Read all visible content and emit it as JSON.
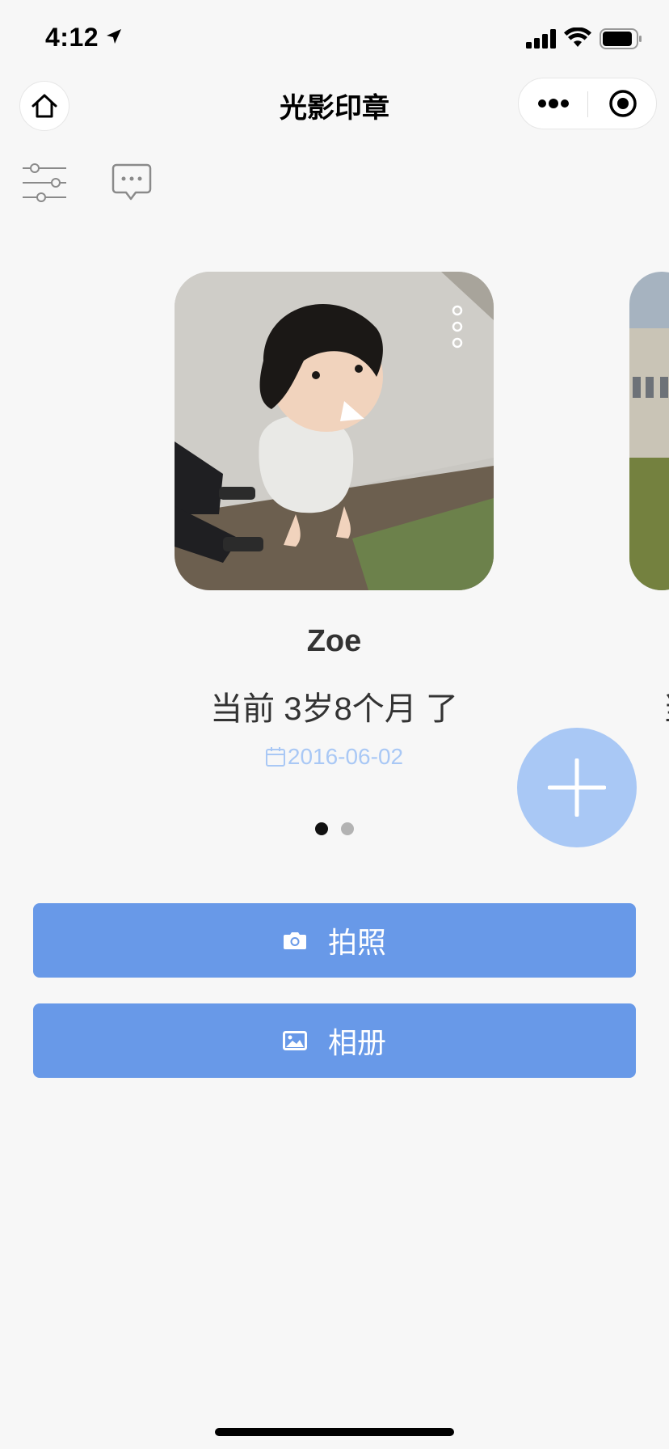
{
  "status_bar": {
    "time": "4:12"
  },
  "nav": {
    "title": "光影印章"
  },
  "card": {
    "name": "Zoe",
    "age_text": "当前 3岁8个月 了",
    "date": "2016-06-02"
  },
  "next_card": {
    "age_text_partial": "当"
  },
  "pagination": {
    "current": 1,
    "total": 2
  },
  "actions": {
    "camera_label": "拍照",
    "album_label": "相册"
  },
  "colors": {
    "primary_button": "#6899e8",
    "fab": "#a9c8f5",
    "date_text": "#a9c8f5",
    "background": "#f7f7f7"
  },
  "icons": {
    "home": "home-icon",
    "more": "more-dots-icon",
    "close": "target-close-icon",
    "filter": "sliders-icon",
    "message": "chat-bubble-icon",
    "card_menu": "vertical-dots-icon",
    "calendar": "calendar-icon",
    "add": "plus-icon",
    "camera": "camera-icon",
    "album": "image-icon"
  }
}
